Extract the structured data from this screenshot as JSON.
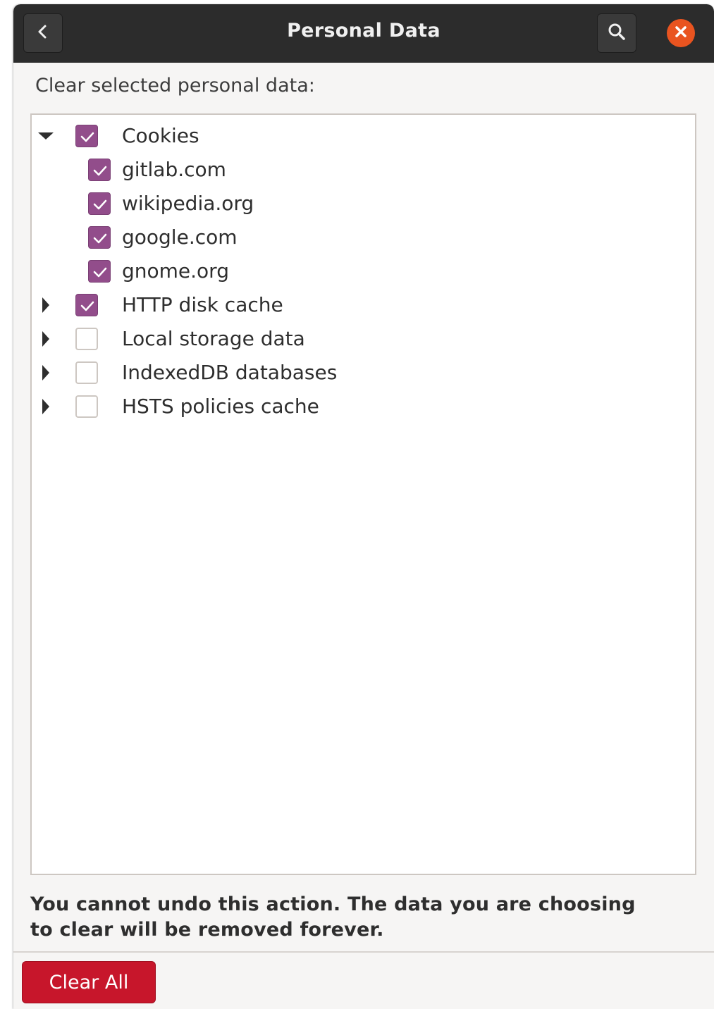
{
  "window": {
    "title": "Personal Data",
    "accent_color": "#924d8b",
    "close_color": "#e95420",
    "destructive_color": "#c7162b"
  },
  "header": {
    "back_icon": "chevron-left-icon",
    "search_icon": "search-icon",
    "close_icon": "close-icon"
  },
  "subtitle": "Clear selected personal data:",
  "tree": {
    "rows": [
      {
        "label": "Cookies",
        "checked": true,
        "expander": "expanded",
        "level": 0
      },
      {
        "label": "gitlab.com",
        "checked": true,
        "expander": "none",
        "level": 1
      },
      {
        "label": "wikipedia.org",
        "checked": true,
        "expander": "none",
        "level": 1
      },
      {
        "label": "google.com",
        "checked": true,
        "expander": "none",
        "level": 1
      },
      {
        "label": "gnome.org",
        "checked": true,
        "expander": "none",
        "level": 1
      },
      {
        "label": "HTTP disk cache",
        "checked": true,
        "expander": "collapsed",
        "level": 0
      },
      {
        "label": "Local storage data",
        "checked": false,
        "expander": "collapsed",
        "level": 0
      },
      {
        "label": "IndexedDB databases",
        "checked": false,
        "expander": "collapsed",
        "level": 0
      },
      {
        "label": "HSTS policies cache",
        "checked": false,
        "expander": "collapsed",
        "level": 0
      }
    ]
  },
  "warning": {
    "line1": "You cannot undo this action. The data you are choosing",
    "line2": "to clear will be removed forever."
  },
  "footer": {
    "clear_all_label": "Clear All"
  }
}
